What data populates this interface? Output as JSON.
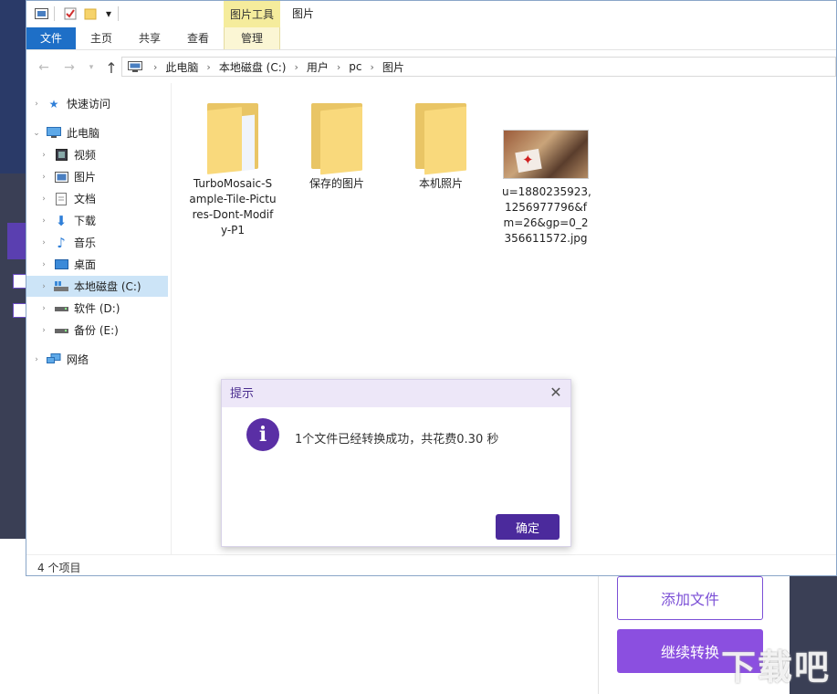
{
  "quick_access_toolbar": {
    "dropdown": "▾"
  },
  "titlebar": {
    "picture_tools": "图片工具",
    "title": "图片"
  },
  "ribbon": {
    "tabs": [
      "文件",
      "主页",
      "共享",
      "查看",
      "管理"
    ]
  },
  "address": {
    "crumbs": [
      "此电脑",
      "本地磁盘 (C:)",
      "用户",
      "pc",
      "图片"
    ]
  },
  "nav": {
    "quick_access": "快速访问",
    "this_pc": "此电脑",
    "items": [
      "视频",
      "图片",
      "文档",
      "下载",
      "音乐",
      "桌面",
      "本地磁盘 (C:)",
      "软件 (D:)",
      "备份 (E:)"
    ],
    "network": "网络"
  },
  "files": [
    {
      "name": "TurboMosaic-Sample-Tile-Pictures-Dont-Modify-P1",
      "lines": [
        "TurboMosaic-S",
        "ample-Tile-Pictu",
        "res-Dont-Modif",
        "y-P1"
      ]
    },
    {
      "name": "保存的图片",
      "lines": [
        "保存的图片"
      ]
    },
    {
      "name": "本机照片",
      "lines": [
        "本机照片"
      ]
    },
    {
      "name": "u=1880235923,1256977796&fm=26&gp=0_2356611572.jpg",
      "lines": [
        "u=1880235923,",
        "1256977796&f",
        "m=26&gp=0_2",
        "356611572.jpg"
      ]
    }
  ],
  "status": {
    "count": "4 个项目"
  },
  "dialog": {
    "title": "提示",
    "message": "1个文件已经转换成功，共花费0.30 秒",
    "ok": "确定",
    "close": "✕",
    "icon_glyph": "i"
  },
  "background_app": {
    "add_file": "添加文件",
    "continue_convert": "继续转换",
    "watermark": "下载吧"
  },
  "colors": {
    "accent_purple": "#5a2fa5",
    "ribbon_file_blue": "#1e6fc7",
    "picture_tools_yellow": "#f5ec9c"
  }
}
